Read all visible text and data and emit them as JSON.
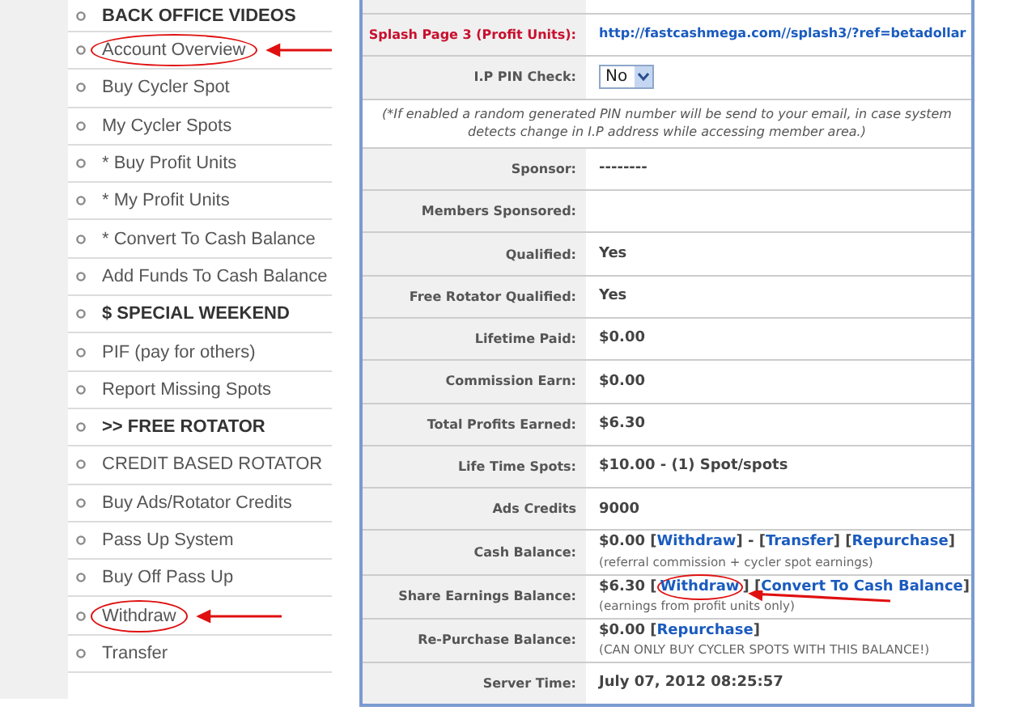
{
  "sidebar": {
    "items": [
      {
        "text": "BACK OFFICE VIDEOS",
        "kind": "heading",
        "circled": false
      },
      {
        "text": "Account Overview",
        "kind": "link",
        "circled": true
      },
      {
        "text": "Buy Cycler Spot",
        "kind": "link",
        "circled": false
      },
      {
        "text": "My Cycler Spots",
        "kind": "link",
        "circled": false
      },
      {
        "text": "* Buy Profit Units",
        "kind": "link",
        "circled": false
      },
      {
        "text": "* My Profit Units",
        "kind": "link",
        "circled": false
      },
      {
        "text": "* Convert To Cash Balance",
        "kind": "link",
        "circled": false
      },
      {
        "text": "Add Funds To Cash Balance",
        "kind": "link",
        "circled": false
      },
      {
        "text": "$ SPECIAL WEEKEND",
        "kind": "heading",
        "circled": false
      },
      {
        "text": "PIF (pay for others)",
        "kind": "link",
        "circled": false
      },
      {
        "text": "Report Missing Spots",
        "kind": "link",
        "circled": false
      },
      {
        "text": ">> FREE ROTATOR",
        "kind": "heading",
        "circled": false
      },
      {
        "text": "CREDIT BASED ROTATOR",
        "kind": "link",
        "circled": false
      },
      {
        "text": "Buy Ads/Rotator Credits",
        "kind": "link",
        "circled": false
      },
      {
        "text": "Pass Up System",
        "kind": "link",
        "circled": false
      },
      {
        "text": "Buy Off Pass Up",
        "kind": "link",
        "circled": false
      },
      {
        "text": "Withdraw",
        "kind": "link",
        "circled": true
      },
      {
        "text": "Transfer",
        "kind": "link",
        "circled": false
      }
    ]
  },
  "account_table": {
    "rows": [
      {
        "kind": "field",
        "label": "Splash Page 3 (Profit Units):",
        "alert": true,
        "value": [
          {
            "kind": "link",
            "text": "http://fastcashmega.com//splash3/?ref=betadollar",
            "circled": false
          }
        ]
      },
      {
        "kind": "select",
        "label": "I.P PIN Check:",
        "alert": false,
        "select_value": "No"
      },
      {
        "kind": "note",
        "text": "(*If enabled a random generated PIN number will be send to your email, in case system detects change in I.P address while accessing member area.)"
      },
      {
        "kind": "field",
        "label": "Sponsor:",
        "alert": false,
        "value": [
          {
            "kind": "text",
            "text": "--------"
          }
        ]
      },
      {
        "kind": "field",
        "label": "Members Sponsored:",
        "alert": false,
        "value": []
      },
      {
        "kind": "field",
        "label": "Qualified:",
        "alert": false,
        "value": [
          {
            "kind": "text",
            "text": "Yes"
          }
        ]
      },
      {
        "kind": "field",
        "label": "Free Rotator Qualified:",
        "alert": false,
        "value": [
          {
            "kind": "text",
            "text": "Yes"
          }
        ]
      },
      {
        "kind": "field",
        "label": "Lifetime Paid:",
        "alert": false,
        "value": [
          {
            "kind": "text",
            "text": "$0.00"
          }
        ]
      },
      {
        "kind": "field",
        "label": "Commission Earn:",
        "alert": false,
        "value": [
          {
            "kind": "text",
            "text": "$0.00"
          }
        ]
      },
      {
        "kind": "field",
        "label": "Total Profits Earned:",
        "alert": false,
        "value": [
          {
            "kind": "text",
            "text": "$6.30"
          }
        ]
      },
      {
        "kind": "field",
        "label": "Life Time Spots:",
        "alert": false,
        "value": [
          {
            "kind": "text",
            "text": "$10.00 - (1) Spot/spots"
          }
        ]
      },
      {
        "kind": "field",
        "label": "Ads Credits",
        "alert": false,
        "value": [
          {
            "kind": "text",
            "text": "9000"
          }
        ]
      },
      {
        "kind": "field",
        "label": "Cash Balance:",
        "alert": false,
        "value": [
          {
            "kind": "text",
            "text": "$0.00 ["
          },
          {
            "kind": "link",
            "text": "Withdraw",
            "circled": false
          },
          {
            "kind": "text",
            "text": "] - ["
          },
          {
            "kind": "link",
            "text": "Transfer",
            "circled": false
          },
          {
            "kind": "text",
            "text": "] ["
          },
          {
            "kind": "link",
            "text": "Repurchase",
            "circled": false
          },
          {
            "kind": "text",
            "text": "]"
          }
        ],
        "note": "(referral commission + cycler spot earnings)"
      },
      {
        "kind": "field",
        "label": "Share Earnings Balance:",
        "alert": false,
        "value": [
          {
            "kind": "text",
            "text": "$6.30 ["
          },
          {
            "kind": "link",
            "text": "Withdraw",
            "circled": true
          },
          {
            "kind": "text",
            "text": "] ["
          },
          {
            "kind": "link",
            "text": "Convert To Cash Balance",
            "circled": false
          },
          {
            "kind": "text",
            "text": "]"
          }
        ],
        "note": "(earnings from profit units only)"
      },
      {
        "kind": "field",
        "label": "Re-Purchase Balance:",
        "alert": false,
        "value": [
          {
            "kind": "text",
            "text": "$0.00 ["
          },
          {
            "kind": "link",
            "text": "Repurchase",
            "circled": false
          },
          {
            "kind": "text",
            "text": "]"
          }
        ],
        "note": "(CAN ONLY BUY CYCLER SPOTS WITH THIS BALANCE!)"
      },
      {
        "kind": "field",
        "label": "Server Time:",
        "alert": false,
        "value": [
          {
            "kind": "text",
            "text": "July 07, 2012 08:25:57"
          }
        ]
      }
    ]
  }
}
